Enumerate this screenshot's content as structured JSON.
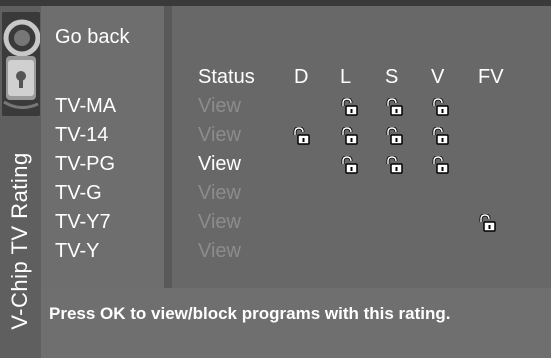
{
  "window": {
    "title": "V-Chip TV Rating"
  },
  "menu": {
    "go_back": "Go back"
  },
  "columns": {
    "status": "Status",
    "d": "D",
    "l": "L",
    "s": "S",
    "v": "V",
    "fv": "FV"
  },
  "ratings": [
    {
      "label": "TV-MA",
      "status": "View",
      "selected": false,
      "locks": [
        "L",
        "S",
        "V"
      ]
    },
    {
      "label": "TV-14",
      "status": "View",
      "selected": false,
      "locks": [
        "D",
        "L",
        "S",
        "V"
      ]
    },
    {
      "label": "TV-PG",
      "status": "View",
      "selected": true,
      "locks": [
        "L",
        "S",
        "V"
      ]
    },
    {
      "label": "TV-G",
      "status": "View",
      "selected": false,
      "locks": []
    },
    {
      "label": "TV-Y7",
      "status": "View",
      "selected": false,
      "locks": [
        "FV"
      ]
    },
    {
      "label": "TV-Y",
      "status": "View",
      "selected": false,
      "locks": []
    }
  ],
  "hint": "Press OK to view/block programs with this rating.",
  "colors": {
    "active_text": "#ffffff",
    "dim_text": "#8c8c8c",
    "lock_fill": "#ffffff"
  },
  "icons": {
    "lock": "padlock-icon",
    "art": "lock-art-icon"
  }
}
